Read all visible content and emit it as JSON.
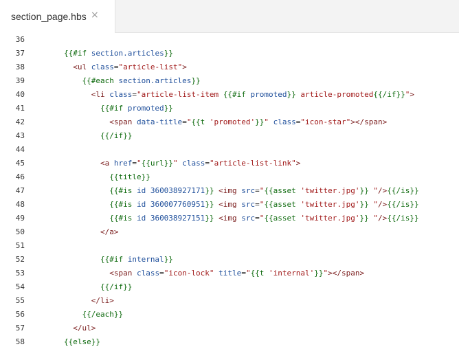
{
  "tab": {
    "label": "section_page.hbs",
    "close_glyph": "×"
  },
  "colors": {
    "handlebars": "#0e6a0e",
    "plain": "#333333",
    "keyword": "#1f4f9b",
    "tag": "#7a1c1c",
    "attribute": "#1f4f9b",
    "string": "#a11a1a"
  },
  "lines": [
    {
      "num": "36",
      "tokens": []
    },
    {
      "num": "37",
      "tokens": [
        {
          "t": "{{#if",
          "c": "h"
        },
        {
          "t": " section.articles",
          "c": "k"
        },
        {
          "t": "}}",
          "c": "h"
        }
      ]
    },
    {
      "num": "38",
      "tokens": [
        {
          "t": "  <ul",
          "c": "tag"
        },
        {
          "t": " class",
          "c": "a"
        },
        {
          "t": "=",
          "c": "p"
        },
        {
          "t": "\"article-list\"",
          "c": "s"
        },
        {
          "t": ">",
          "c": "tag"
        }
      ]
    },
    {
      "num": "39",
      "tokens": [
        {
          "t": "    {{#each",
          "c": "h"
        },
        {
          "t": " section.articles",
          "c": "k"
        },
        {
          "t": "}}",
          "c": "h"
        }
      ]
    },
    {
      "num": "40",
      "tokens": [
        {
          "t": "      <li",
          "c": "tag"
        },
        {
          "t": " class",
          "c": "a"
        },
        {
          "t": "=",
          "c": "p"
        },
        {
          "t": "\"article-list-item ",
          "c": "s"
        },
        {
          "t": "{{#if",
          "c": "h"
        },
        {
          "t": " promoted",
          "c": "k"
        },
        {
          "t": "}}",
          "c": "h"
        },
        {
          "t": " article-promoted",
          "c": "s"
        },
        {
          "t": "{{/if}}",
          "c": "h"
        },
        {
          "t": "\"",
          "c": "s"
        },
        {
          "t": ">",
          "c": "tag"
        }
      ]
    },
    {
      "num": "41",
      "tokens": [
        {
          "t": "        {{#if",
          "c": "h"
        },
        {
          "t": " promoted",
          "c": "k"
        },
        {
          "t": "}}",
          "c": "h"
        }
      ]
    },
    {
      "num": "42",
      "tokens": [
        {
          "t": "          <span",
          "c": "tag"
        },
        {
          "t": " data-title",
          "c": "a"
        },
        {
          "t": "=",
          "c": "p"
        },
        {
          "t": "\"",
          "c": "s"
        },
        {
          "t": "{{t",
          "c": "h"
        },
        {
          "t": " 'promoted'",
          "c": "s"
        },
        {
          "t": "}}",
          "c": "h"
        },
        {
          "t": "\"",
          "c": "s"
        },
        {
          "t": " class",
          "c": "a"
        },
        {
          "t": "=",
          "c": "p"
        },
        {
          "t": "\"icon-star\"",
          "c": "s"
        },
        {
          "t": "></span>",
          "c": "tag"
        }
      ]
    },
    {
      "num": "43",
      "tokens": [
        {
          "t": "        {{/if}}",
          "c": "h"
        }
      ]
    },
    {
      "num": "44",
      "tokens": []
    },
    {
      "num": "45",
      "tokens": [
        {
          "t": "        <a",
          "c": "tag"
        },
        {
          "t": " href",
          "c": "a"
        },
        {
          "t": "=",
          "c": "p"
        },
        {
          "t": "\"",
          "c": "s"
        },
        {
          "t": "{{url}}",
          "c": "h"
        },
        {
          "t": "\"",
          "c": "s"
        },
        {
          "t": " class",
          "c": "a"
        },
        {
          "t": "=",
          "c": "p"
        },
        {
          "t": "\"article-list-link\"",
          "c": "s"
        },
        {
          "t": ">",
          "c": "tag"
        }
      ]
    },
    {
      "num": "46",
      "tokens": [
        {
          "t": "          {{title}}",
          "c": "h"
        }
      ]
    },
    {
      "num": "47",
      "tokens": [
        {
          "t": "          {{#is",
          "c": "h"
        },
        {
          "t": " id 360038927171",
          "c": "k"
        },
        {
          "t": "}}",
          "c": "h"
        },
        {
          "t": " <img",
          "c": "tag"
        },
        {
          "t": " src",
          "c": "a"
        },
        {
          "t": "=",
          "c": "p"
        },
        {
          "t": "\"",
          "c": "s"
        },
        {
          "t": "{{asset",
          "c": "h"
        },
        {
          "t": " 'twitter.jpg'",
          "c": "s"
        },
        {
          "t": "}}",
          "c": "h"
        },
        {
          "t": " \"",
          "c": "s"
        },
        {
          "t": "/>",
          "c": "tag"
        },
        {
          "t": "{{/is}}",
          "c": "h"
        }
      ]
    },
    {
      "num": "48",
      "tokens": [
        {
          "t": "          {{#is",
          "c": "h"
        },
        {
          "t": " id 360007760951",
          "c": "k"
        },
        {
          "t": "}}",
          "c": "h"
        },
        {
          "t": " <img",
          "c": "tag"
        },
        {
          "t": " src",
          "c": "a"
        },
        {
          "t": "=",
          "c": "p"
        },
        {
          "t": "\"",
          "c": "s"
        },
        {
          "t": "{{asset",
          "c": "h"
        },
        {
          "t": " 'twitter.jpg'",
          "c": "s"
        },
        {
          "t": "}}",
          "c": "h"
        },
        {
          "t": " \"",
          "c": "s"
        },
        {
          "t": "/>",
          "c": "tag"
        },
        {
          "t": "{{/is}}",
          "c": "h"
        }
      ]
    },
    {
      "num": "49",
      "tokens": [
        {
          "t": "          {{#is",
          "c": "h"
        },
        {
          "t": " id 360038927151",
          "c": "k"
        },
        {
          "t": "}}",
          "c": "h"
        },
        {
          "t": " <img",
          "c": "tag"
        },
        {
          "t": " src",
          "c": "a"
        },
        {
          "t": "=",
          "c": "p"
        },
        {
          "t": "\"",
          "c": "s"
        },
        {
          "t": "{{asset",
          "c": "h"
        },
        {
          "t": " 'twitter.jpg'",
          "c": "s"
        },
        {
          "t": "}}",
          "c": "h"
        },
        {
          "t": " \"",
          "c": "s"
        },
        {
          "t": "/>",
          "c": "tag"
        },
        {
          "t": "{{/is}}",
          "c": "h"
        }
      ]
    },
    {
      "num": "50",
      "tokens": [
        {
          "t": "        </a>",
          "c": "tag"
        }
      ]
    },
    {
      "num": "51",
      "tokens": []
    },
    {
      "num": "52",
      "tokens": [
        {
          "t": "        {{#if",
          "c": "h"
        },
        {
          "t": " internal",
          "c": "k"
        },
        {
          "t": "}}",
          "c": "h"
        }
      ]
    },
    {
      "num": "53",
      "tokens": [
        {
          "t": "          <span",
          "c": "tag"
        },
        {
          "t": " class",
          "c": "a"
        },
        {
          "t": "=",
          "c": "p"
        },
        {
          "t": "\"icon-lock\"",
          "c": "s"
        },
        {
          "t": " title",
          "c": "a"
        },
        {
          "t": "=",
          "c": "p"
        },
        {
          "t": "\"",
          "c": "s"
        },
        {
          "t": "{{t",
          "c": "h"
        },
        {
          "t": " 'internal'",
          "c": "s"
        },
        {
          "t": "}}",
          "c": "h"
        },
        {
          "t": "\"",
          "c": "s"
        },
        {
          "t": "></span>",
          "c": "tag"
        }
      ]
    },
    {
      "num": "54",
      "tokens": [
        {
          "t": "        {{/if}}",
          "c": "h"
        }
      ]
    },
    {
      "num": "55",
      "tokens": [
        {
          "t": "      </li>",
          "c": "tag"
        }
      ]
    },
    {
      "num": "56",
      "tokens": [
        {
          "t": "    {{/each}}",
          "c": "h"
        }
      ]
    },
    {
      "num": "57",
      "tokens": [
        {
          "t": "  </ul>",
          "c": "tag"
        }
      ]
    },
    {
      "num": "58",
      "tokens": [
        {
          "t": "{{else}}",
          "c": "h"
        }
      ]
    }
  ]
}
